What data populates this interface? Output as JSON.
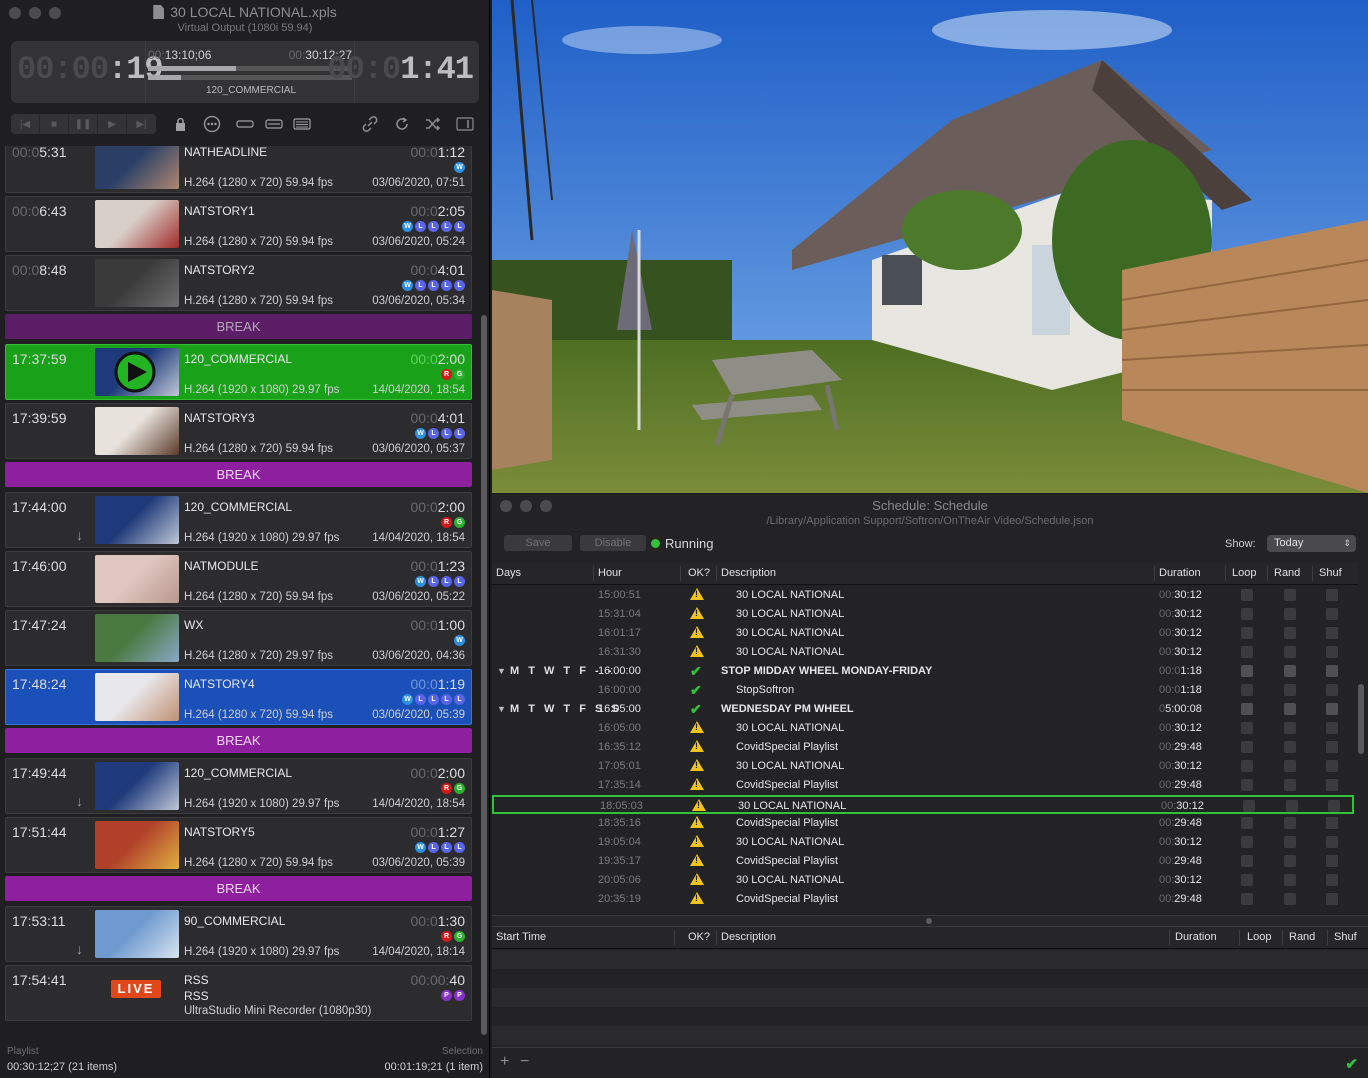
{
  "left_window": {
    "title": "30 LOCAL NATIONAL.xpls",
    "subtitle": "Virtual Output (1080i 59.94)",
    "elapsed_dim": "00:00",
    "elapsed_lit": ":19",
    "remaining_dim": "00:0",
    "remaining_lit": "1:41",
    "tc_left_dim": "00:",
    "tc_left_lit": "13:10;06",
    "tc_right_dim": "00:",
    "tc_right_lit": "30:12;27",
    "now_playing": "120_COMMERCIAL",
    "progress_main": 0.43,
    "progress_clip": 0.16
  },
  "playlist": [
    {
      "type": "item",
      "time_dim": "00:0",
      "time": "5:31",
      "name": "NATHEADLINE",
      "format": "H.264 (1280 x 720) 59.94 fps",
      "dur_dim": "00:0",
      "dur": "1:12",
      "date": "03/06/2020, 07:51",
      "badges": [
        "W"
      ]
    },
    {
      "type": "item",
      "time_dim": "00:0",
      "time": "6:43",
      "name": "NATSTORY1",
      "format": "H.264 (1280 x 720) 59.94 fps",
      "dur_dim": "00:0",
      "dur": "2:05",
      "date": "03/06/2020, 05:24",
      "badges": [
        "W",
        "L",
        "L",
        "L",
        "L"
      ]
    },
    {
      "type": "item",
      "time_dim": "00:0",
      "time": "8:48",
      "name": "NATSTORY2",
      "format": "H.264 (1280 x 720) 59.94 fps",
      "dur_dim": "00:0",
      "dur": "4:01",
      "date": "03/06/2020, 05:34",
      "badges": [
        "W",
        "L",
        "L",
        "L",
        "L"
      ]
    },
    {
      "type": "break",
      "label": "BREAK",
      "dark": true
    },
    {
      "type": "item",
      "state": "playing",
      "time_dim": "",
      "time": "17:37:59",
      "name": "120_COMMERCIAL",
      "format": "H.264 (1920 x 1080) 29.97 fps",
      "dur_dim": "00:0",
      "dur": "2:00",
      "date": "14/04/2020, 18:54",
      "badges": [
        "R",
        "G"
      ]
    },
    {
      "type": "item",
      "time_dim": "",
      "time": "17:39:59",
      "name": "NATSTORY3",
      "format": "H.264 (1280 x 720) 59.94 fps",
      "dur_dim": "00:0",
      "dur": "4:01",
      "date": "03/06/2020, 05:37",
      "badges": [
        "W",
        "L",
        "L",
        "L"
      ]
    },
    {
      "type": "break",
      "label": "BREAK"
    },
    {
      "type": "item",
      "time_dim": "",
      "time": "17:44:00",
      "name": "120_COMMERCIAL",
      "format": "H.264 (1920 x 1080) 29.97 fps",
      "dur_dim": "00:0",
      "dur": "2:00",
      "date": "14/04/2020, 18:54",
      "badges": [
        "R",
        "G"
      ],
      "arrow": true
    },
    {
      "type": "item",
      "time_dim": "",
      "time": "17:46:00",
      "name": "NATMODULE",
      "format": "H.264 (1280 x 720) 59.94 fps",
      "dur_dim": "00:0",
      "dur": "1:23",
      "date": "03/06/2020, 05:22",
      "badges": [
        "W",
        "L",
        "L",
        "L"
      ]
    },
    {
      "type": "item",
      "time_dim": "",
      "time": "17:47:24",
      "name": "WX",
      "format": "H.264 (1280 x 720) 29.97 fps",
      "dur_dim": "00:0",
      "dur": "1:00",
      "date": "03/06/2020, 04:36",
      "badges": [
        "W"
      ]
    },
    {
      "type": "item",
      "state": "selected",
      "time_dim": "",
      "time": "17:48:24",
      "name": "NATSTORY4",
      "format": "H.264 (1280 x 720) 59.94 fps",
      "dur_dim": "00:0",
      "dur": "1:19",
      "date": "03/06/2020, 05:39",
      "badges": [
        "W",
        "L",
        "L",
        "L",
        "L"
      ]
    },
    {
      "type": "break",
      "label": "BREAK"
    },
    {
      "type": "item",
      "time_dim": "",
      "time": "17:49:44",
      "name": "120_COMMERCIAL",
      "format": "H.264 (1920 x 1080) 29.97 fps",
      "dur_dim": "00:0",
      "dur": "2:00",
      "date": "14/04/2020, 18:54",
      "badges": [
        "R",
        "G"
      ],
      "arrow": true
    },
    {
      "type": "item",
      "time_dim": "",
      "time": "17:51:44",
      "name": "NATSTORY5",
      "format": "H.264 (1280 x 720) 59.94 fps",
      "dur_dim": "00:0",
      "dur": "1:27",
      "date": "03/06/2020, 05:39",
      "badges": [
        "W",
        "L",
        "L",
        "L"
      ]
    },
    {
      "type": "break",
      "label": "BREAK"
    },
    {
      "type": "item",
      "time_dim": "",
      "time": "17:53:11",
      "name": "90_COMMERCIAL",
      "format": "H.264 (1920 x 1080) 29.97 fps",
      "dur_dim": "00:0",
      "dur": "1:30",
      "date": "14/04/2020, 18:14",
      "badges": [
        "R",
        "G"
      ],
      "arrow": true
    },
    {
      "type": "live",
      "time_dim": "",
      "time": "17:54:41",
      "name": "RSS",
      "sub": "RSS",
      "format": "UltraStudio Mini Recorder (1080p30)",
      "dur_dim": "00:00:",
      "dur": "40",
      "date": "",
      "badges": [
        "P",
        "P"
      ],
      "live_label": "LIVE"
    }
  ],
  "footer": {
    "left_label": "Playlist",
    "left_value": "00:30:12;27 (21 items)",
    "right_label": "Selection",
    "right_value": "00:01:19;21 (1 item)"
  },
  "schedule": {
    "title": "Schedule: Schedule",
    "path": "/Library/Application Support/Softron/OnTheAir Video/Schedule.json",
    "save_label": "Save",
    "disable_label": "Disable",
    "status": "Running",
    "show_label": "Show:",
    "show_value": "Today",
    "columns": {
      "days": "Days",
      "hour": "Hour",
      "ok": "OK?",
      "description": "Description",
      "duration": "Duration",
      "loop": "Loop",
      "rand": "Rand",
      "shuf": "Shuf"
    },
    "rows": [
      {
        "days": "",
        "hour": "15:00:51",
        "ok": "warn",
        "desc": "30 LOCAL NATIONAL",
        "dur_dim": "00:",
        "dur": "30:12"
      },
      {
        "days": "",
        "hour": "15:31:04",
        "ok": "warn",
        "desc": "30 LOCAL NATIONAL",
        "dur_dim": "00:",
        "dur": "30:12"
      },
      {
        "days": "",
        "hour": "16:01:17",
        "ok": "warn",
        "desc": "30 LOCAL NATIONAL",
        "dur_dim": "00:",
        "dur": "30:12"
      },
      {
        "days": "",
        "hour": "16:31:30",
        "ok": "warn",
        "desc": "30 LOCAL NATIONAL",
        "dur_dim": "00:",
        "dur": "30:12"
      },
      {
        "group": true,
        "days": "M T W T F - -",
        "hour": "16:00:00",
        "ok": "check",
        "desc": "STOP MIDDAY WHEEL MONDAY-FRIDAY",
        "dur_dim": "00:0",
        "dur": "1:18"
      },
      {
        "days": "",
        "hour": "16:00:00",
        "ok": "check",
        "desc": "StopSoftron",
        "dur_dim": "00:0",
        "dur": "1:18"
      },
      {
        "group": true,
        "days": "M T W T F S S",
        "hour": "16:05:00",
        "ok": "check",
        "desc": "WEDNESDAY PM WHEEL",
        "dur_dim": "0",
        "dur": "5:00:08"
      },
      {
        "days": "",
        "hour": "16:05:00",
        "ok": "warn",
        "desc": "30 LOCAL NATIONAL",
        "dur_dim": "00:",
        "dur": "30:12"
      },
      {
        "days": "",
        "hour": "16:35:12",
        "ok": "warn",
        "desc": "CovidSpecial Playlist",
        "dur_dim": "00:",
        "dur": "29:48"
      },
      {
        "days": "",
        "hour": "17:05:01",
        "ok": "warn",
        "desc": "30 LOCAL NATIONAL",
        "dur_dim": "00:",
        "dur": "30:12"
      },
      {
        "days": "",
        "hour": "17:35:14",
        "ok": "warn",
        "desc": "CovidSpecial Playlist",
        "dur_dim": "00:",
        "dur": "29:48"
      },
      {
        "days": "",
        "hour": "18:05:03",
        "ok": "warn",
        "desc": "30 LOCAL NATIONAL",
        "dur_dim": "00:",
        "dur": "30:12",
        "highlight": true
      },
      {
        "days": "",
        "hour": "18:35:16",
        "ok": "warn",
        "desc": "CovidSpecial Playlist",
        "dur_dim": "00:",
        "dur": "29:48"
      },
      {
        "days": "",
        "hour": "19:05:04",
        "ok": "warn",
        "desc": "30 LOCAL NATIONAL",
        "dur_dim": "00:",
        "dur": "30:12"
      },
      {
        "days": "",
        "hour": "19:35:17",
        "ok": "warn",
        "desc": "CovidSpecial Playlist",
        "dur_dim": "00:",
        "dur": "29:48"
      },
      {
        "days": "",
        "hour": "20:05:06",
        "ok": "warn",
        "desc": "30 LOCAL NATIONAL",
        "dur_dim": "00:",
        "dur": "30:12"
      },
      {
        "days": "",
        "hour": "20:35:19",
        "ok": "warn",
        "desc": "CovidSpecial Playlist",
        "dur_dim": "00:",
        "dur": "29:48"
      }
    ],
    "lower_columns": {
      "start": "Start Time",
      "ok": "OK?",
      "description": "Description",
      "duration": "Duration",
      "loop": "Loop",
      "rand": "Rand",
      "shuf": "Shuf"
    },
    "add_label": "+",
    "remove_label": "−"
  }
}
